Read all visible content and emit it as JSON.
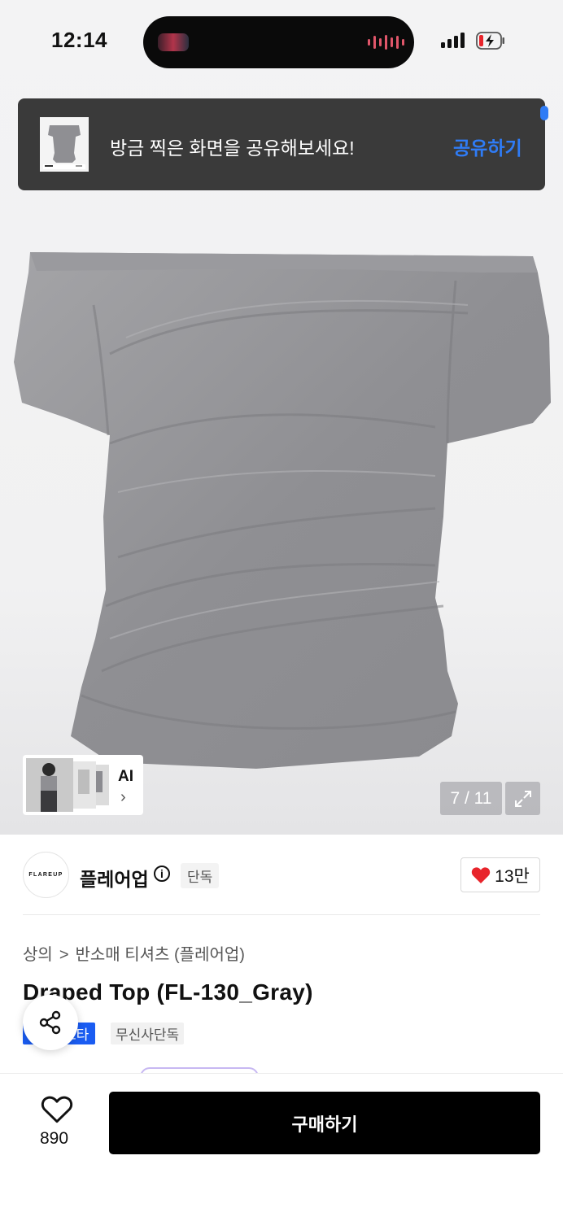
{
  "status_bar": {
    "time": "12:14"
  },
  "toast": {
    "message": "방금 찍은 화면을 공유해보세요!",
    "action_label": "공유하기"
  },
  "gallery": {
    "ai_label": "AI",
    "ai_chevron": "›",
    "page_indicator": "7 / 11"
  },
  "brand": {
    "logo_text": "FLAREUP",
    "name": "플레어업",
    "info_symbol": "i",
    "exclusive_badge": "단독",
    "like_count": "13만"
  },
  "breadcrumb": {
    "category": "상의",
    "separator": ">",
    "subcategory": "반소매 티셔츠 (플레어업)"
  },
  "product": {
    "title": "Draped Top (FL-130_Gray)",
    "tag_primary": "스타",
    "tag_secondary": "무신사단독"
  },
  "bottom_bar": {
    "like_total": "890",
    "buy_label": "구매하기"
  },
  "icons": {
    "share": "share-icon",
    "heart_filled": "heart-icon",
    "heart_outline": "heart-outline-icon",
    "expand": "expand-icon",
    "info": "info-icon",
    "battery": "battery-charging-icon",
    "signal": "signal-icon"
  },
  "colors": {
    "accent_blue": "#2f7cf6",
    "tag_blue": "#1a5cf2",
    "heart_red": "#e8242b",
    "toast_bg": "#3a3a3a",
    "buy_button": "#000000"
  }
}
